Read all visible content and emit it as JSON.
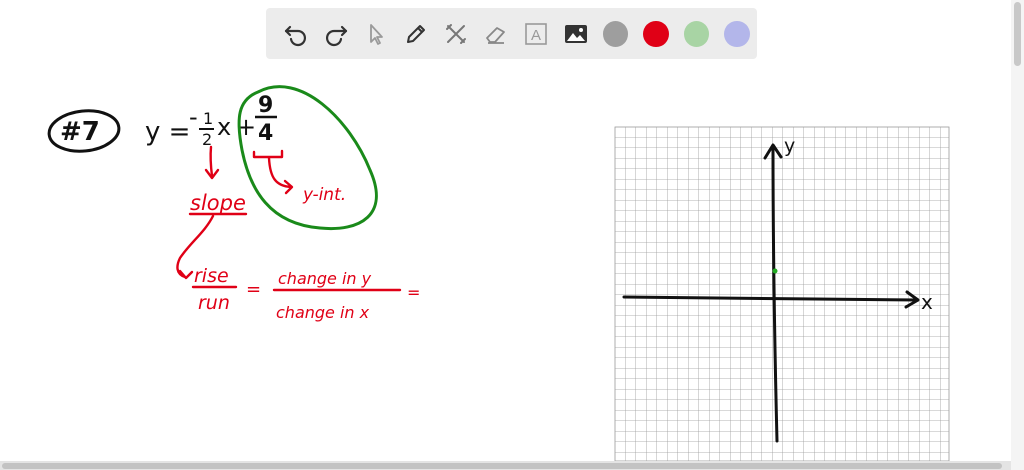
{
  "toolbar": {
    "tools": [
      {
        "icon": "undo-icon"
      },
      {
        "icon": "redo-icon"
      },
      {
        "icon": "pointer-icon"
      },
      {
        "icon": "pen-icon"
      },
      {
        "icon": "tools-icon"
      },
      {
        "icon": "eraser-icon"
      },
      {
        "icon": "text-icon",
        "label": "A"
      },
      {
        "icon": "image-icon"
      }
    ],
    "colors": [
      "#9e9e9e",
      "#e00016",
      "#a8d4a4",
      "#b3b6ea"
    ]
  },
  "notes": {
    "problem_label": "#7",
    "equation_lhs": "y =",
    "slope_num": "1",
    "slope_den": "2",
    "minus": "-",
    "x_var": "x",
    "plus": "+",
    "int_num": "9",
    "int_den": "4",
    "slope_label": "slope",
    "yint_label": "y-int.",
    "rise": "rise",
    "run": "run",
    "equals": "=",
    "change_y": "change in y",
    "change_x": "change in x",
    "trailing_eq": "="
  },
  "graph": {
    "x_label": "x",
    "y_label": "y"
  }
}
